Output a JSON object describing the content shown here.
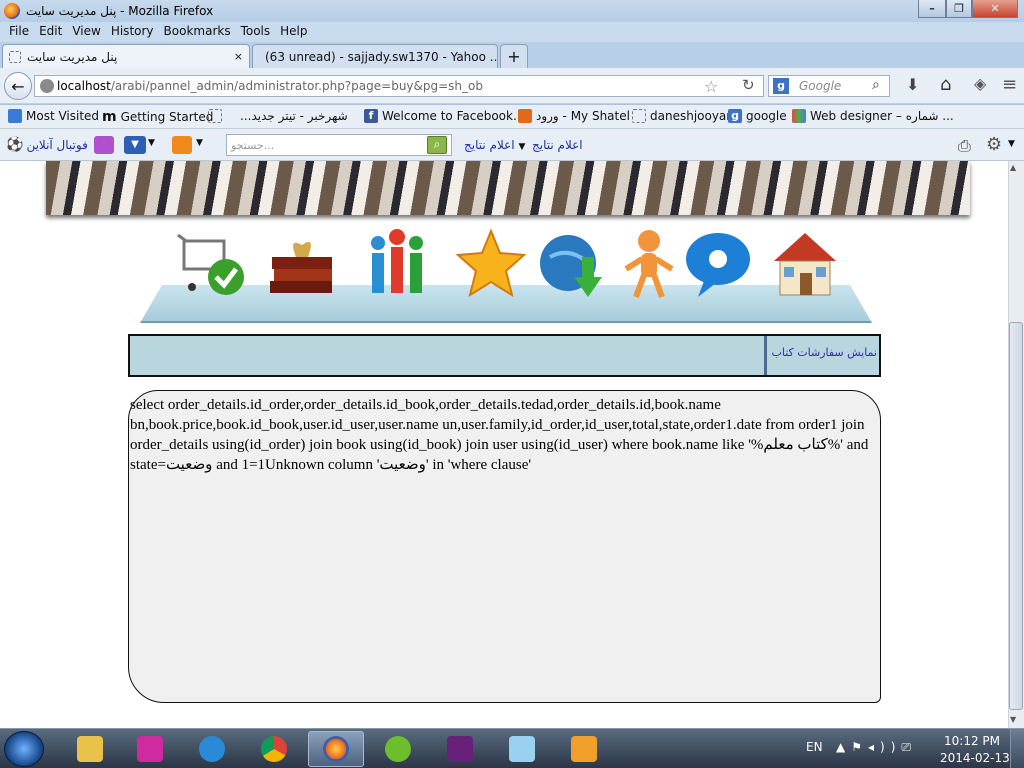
{
  "window": {
    "title": "پنل مدیریت سایت - Mozilla Firefox",
    "buttons": {
      "minimize": "–",
      "maximize": "❐",
      "close": "✕"
    }
  },
  "menubar": [
    "File",
    "Edit",
    "View",
    "History",
    "Bookmarks",
    "Tools",
    "Help"
  ],
  "tabs": [
    {
      "label": "پنل مدیریت سایت",
      "active": true,
      "close": "×"
    },
    {
      "label": "(63 unread) - sajjady.sw1370 - Yahoo ...",
      "active": false,
      "close": "×"
    }
  ],
  "new_tab_label": "+",
  "navbar": {
    "url_host": "localhost",
    "url_path": "/arabi/pannel_admin/administrator.php?page=buy&pg=sh_ob",
    "search_placeholder": "Google",
    "search_engine_badge": "g"
  },
  "bookmarks": [
    {
      "label": "Most Visited",
      "icon": "most-visited-icon",
      "color": "#3a7bd5"
    },
    {
      "label": "Getting Started",
      "icon": "mozilla-m-icon",
      "color": "#333333"
    },
    {
      "label": "...شهرخبر - تیتر جدید",
      "icon": "page-icon",
      "color": "#ffffff"
    },
    {
      "label": "Welcome to Facebook...",
      "icon": "facebook-icon",
      "color": "#3b5998"
    },
    {
      "label": "ورود - My Shatel",
      "icon": "shatel-icon",
      "color": "#e06a1a"
    },
    {
      "label": "daneshjooyar",
      "icon": "page-icon",
      "color": "#ffffff"
    },
    {
      "label": "google",
      "icon": "google-icon",
      "color": "#3c73c8"
    },
    {
      "label": "Web designer – شماره ...",
      "icon": "webdesigner-icon",
      "color": "#d04a9a"
    }
  ],
  "toolbar3": {
    "football_label": "فوتبال آنلاین",
    "search_placeholder": "جستجو...",
    "results_menu_label": "اعلام نتایج",
    "results_label": "اعلام نتایج"
  },
  "page": {
    "section_title": "نمایش سفارشات کتاب",
    "nav_icons": [
      "cart-check-icon",
      "books-icon",
      "users-group-icon",
      "star-icon",
      "globe-download-icon",
      "person-icon",
      "chat-bubble-icon",
      "home-icon"
    ],
    "error_text": "select order_details.id_order,order_details.id_book,order_details.tedad,order_details.id,book.name bn,book.price,book.id_book,user.id_user,user.name un,user.family,id_order,id_user,total,state,order1.date from order1 join order_details using(id_order) join book using(id_book) join user using(id_user) where book.name like '%کتاب معلم%' and state=وضعیت and 1=1Unknown column 'وضعیت' in 'where clause'"
  },
  "taskbar": {
    "apps": [
      "explorer-icon",
      "winamp-icon",
      "ie-icon",
      "chrome-icon",
      "firefox-icon",
      "dreamweaver-icon",
      "visual-studio-icon",
      "notepad-icon",
      "pasha-icon"
    ],
    "language": "EN",
    "time": "10:12 PM",
    "date": "2014-02-13"
  }
}
